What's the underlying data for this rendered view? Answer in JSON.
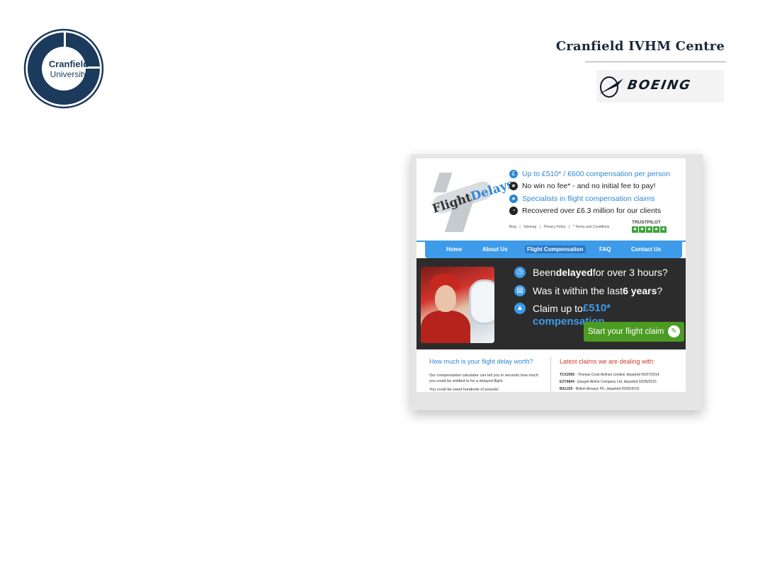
{
  "slide": {
    "university": {
      "line1": "Cranfield",
      "line2": "University"
    },
    "centre_title": "Cranfield IVHM Centre",
    "partner_logo": {
      "name": "boeing-logo",
      "text": "BOEING"
    }
  },
  "website": {
    "brand": {
      "part1": "Flight",
      "part2": "Delays"
    },
    "bullets": [
      {
        "icon": "pound-icon",
        "text": "Up to £510* / €600 compensation per person",
        "style": "blue"
      },
      {
        "icon": "star-icon",
        "text": "No win no fee* - and no initial fee to pay!",
        "style": "dark"
      },
      {
        "icon": "person-icon",
        "text": "Specialists in flight compensation claims",
        "style": "blue"
      },
      {
        "icon": "pie-icon",
        "text": "Recovered over £6.3 million for our clients",
        "style": "dark"
      }
    ],
    "footer_links": [
      "Blog",
      "|",
      "Sitemap",
      "|",
      "Privacy Policy",
      "|",
      "* Terms and Conditions"
    ],
    "trustpilot": {
      "label": "TRUSTPILOT",
      "stars": 5
    },
    "nav": [
      {
        "label": "Home",
        "active": false
      },
      {
        "label": "About Us",
        "active": false
      },
      {
        "label": "Flight Compensation",
        "active": true
      },
      {
        "label": "FAQ",
        "active": false
      },
      {
        "label": "Contact Us",
        "active": false
      }
    ],
    "hero": {
      "q1": {
        "pre": "Been ",
        "bold": "delayed",
        "post": " for over 3 hours?"
      },
      "q2": {
        "pre": "Was it within the last ",
        "bold": "6 years",
        "post": "?"
      },
      "q3": {
        "pre": "Claim up to ",
        "amount": "£510*",
        "line2": "compensation"
      },
      "cta": "Start your flight claim"
    },
    "lower": {
      "left_heading": "How much is your flight delay worth?",
      "left_text": "Our compensation calculator can tell you in seconds how much you could be entitled to for a delayed flight.",
      "left_text2": "You could be owed hundreds of pounds!",
      "right_heading": "Latest claims we are dealing with:",
      "claims": [
        {
          "code": "TCX2995",
          "text": " - Thomas Cook Airlines Limited, departed 05/07/2014"
        },
        {
          "code": "EZY6844",
          "text": " - Easyjet Airline Company Ltd, departed 02/05/2015"
        },
        {
          "code": "BA1335",
          "text": " - British Airways Plc, departed 05/05/2015"
        }
      ]
    }
  },
  "colors": {
    "accent_blue": "#3d9be9",
    "cta_green": "#4c9b22",
    "hero_bg": "#2c2c2c",
    "cranfield_navy": "#1b3a5c"
  }
}
